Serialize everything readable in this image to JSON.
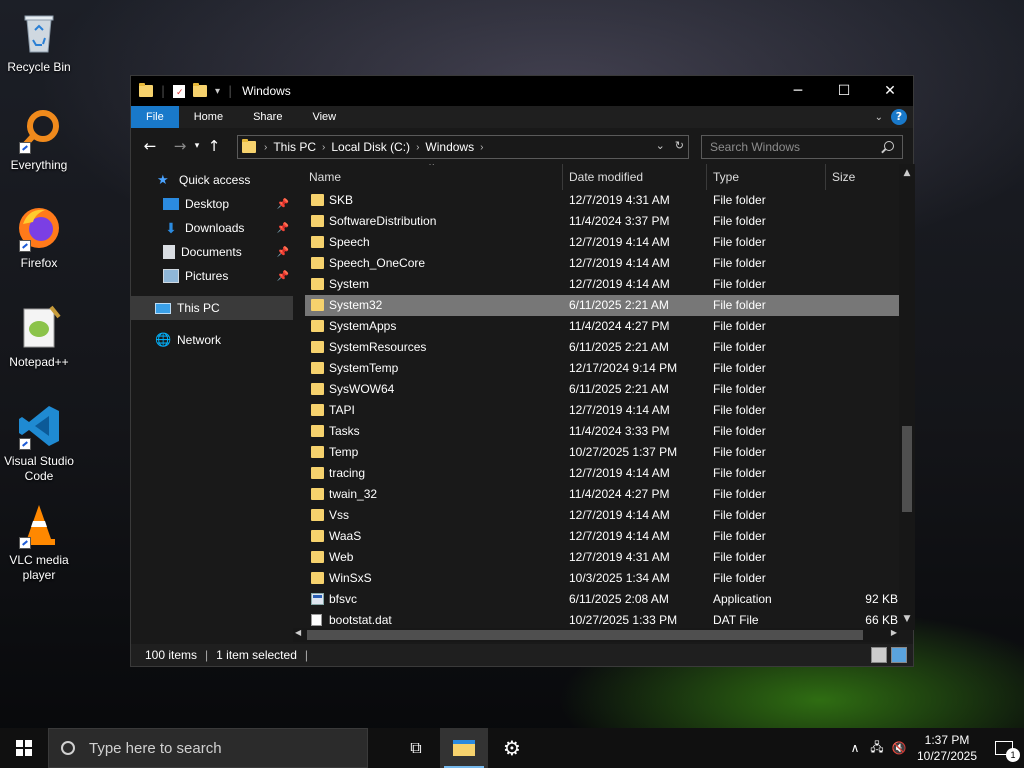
{
  "desktop": {
    "icons": [
      {
        "label": "Recycle Bin"
      },
      {
        "label": "Everything"
      },
      {
        "label": "Firefox"
      },
      {
        "label": "Notepad++"
      },
      {
        "label": "Visual Studio Code"
      },
      {
        "label": "VLC media player"
      }
    ]
  },
  "window": {
    "title": "Windows",
    "ribbon_tabs": [
      "File",
      "Home",
      "Share",
      "View"
    ],
    "help_glyph": "?",
    "caption": {
      "minimize": "─",
      "maximize": "☐",
      "close": "✕"
    },
    "address": {
      "crumbs": [
        "This PC",
        "Local Disk (C:)",
        "Windows"
      ]
    },
    "search_placeholder": "Search Windows",
    "nav": {
      "quick_access": "Quick access",
      "items": [
        {
          "label": "Desktop"
        },
        {
          "label": "Downloads"
        },
        {
          "label": "Documents"
        },
        {
          "label": "Pictures"
        }
      ],
      "this_pc": "This PC",
      "network": "Network"
    },
    "columns": {
      "name": "Name",
      "date": "Date modified",
      "type": "Type",
      "size": "Size"
    },
    "files": [
      {
        "name": "SKB",
        "date": "12/7/2019 4:31 AM",
        "type": "File folder",
        "size": "",
        "icon": "folder"
      },
      {
        "name": "SoftwareDistribution",
        "date": "11/4/2024 3:37 PM",
        "type": "File folder",
        "size": "",
        "icon": "folder"
      },
      {
        "name": "Speech",
        "date": "12/7/2019 4:14 AM",
        "type": "File folder",
        "size": "",
        "icon": "folder"
      },
      {
        "name": "Speech_OneCore",
        "date": "12/7/2019 4:14 AM",
        "type": "File folder",
        "size": "",
        "icon": "folder"
      },
      {
        "name": "System",
        "date": "12/7/2019 4:14 AM",
        "type": "File folder",
        "size": "",
        "icon": "folder"
      },
      {
        "name": "System32",
        "date": "6/11/2025 2:21 AM",
        "type": "File folder",
        "size": "",
        "icon": "folder",
        "selected": true
      },
      {
        "name": "SystemApps",
        "date": "11/4/2024 4:27 PM",
        "type": "File folder",
        "size": "",
        "icon": "folder"
      },
      {
        "name": "SystemResources",
        "date": "6/11/2025 2:21 AM",
        "type": "File folder",
        "size": "",
        "icon": "folder"
      },
      {
        "name": "SystemTemp",
        "date": "12/17/2024 9:14 PM",
        "type": "File folder",
        "size": "",
        "icon": "folder"
      },
      {
        "name": "SysWOW64",
        "date": "6/11/2025 2:21 AM",
        "type": "File folder",
        "size": "",
        "icon": "folder"
      },
      {
        "name": "TAPI",
        "date": "12/7/2019 4:14 AM",
        "type": "File folder",
        "size": "",
        "icon": "folder"
      },
      {
        "name": "Tasks",
        "date": "11/4/2024 3:33 PM",
        "type": "File folder",
        "size": "",
        "icon": "folder"
      },
      {
        "name": "Temp",
        "date": "10/27/2025 1:37 PM",
        "type": "File folder",
        "size": "",
        "icon": "folder"
      },
      {
        "name": "tracing",
        "date": "12/7/2019 4:14 AM",
        "type": "File folder",
        "size": "",
        "icon": "folder"
      },
      {
        "name": "twain_32",
        "date": "11/4/2024 4:27 PM",
        "type": "File folder",
        "size": "",
        "icon": "folder"
      },
      {
        "name": "Vss",
        "date": "12/7/2019 4:14 AM",
        "type": "File folder",
        "size": "",
        "icon": "folder"
      },
      {
        "name": "WaaS",
        "date": "12/7/2019 4:14 AM",
        "type": "File folder",
        "size": "",
        "icon": "folder"
      },
      {
        "name": "Web",
        "date": "12/7/2019 4:31 AM",
        "type": "File folder",
        "size": "",
        "icon": "folder"
      },
      {
        "name": "WinSxS",
        "date": "10/3/2025 1:34 AM",
        "type": "File folder",
        "size": "",
        "icon": "folder"
      },
      {
        "name": "bfsvc",
        "date": "6/11/2025 2:08 AM",
        "type": "Application",
        "size": "92 KB",
        "icon": "app"
      },
      {
        "name": "bootstat.dat",
        "date": "10/27/2025 1:33 PM",
        "type": "DAT File",
        "size": "66 KB",
        "icon": "dat"
      }
    ],
    "status": {
      "items": "100 items",
      "selected": "1 item selected"
    }
  },
  "taskbar": {
    "search_placeholder": "Type here to search",
    "time": "1:37 PM",
    "date": "10/27/2025",
    "notifications": "1"
  }
}
